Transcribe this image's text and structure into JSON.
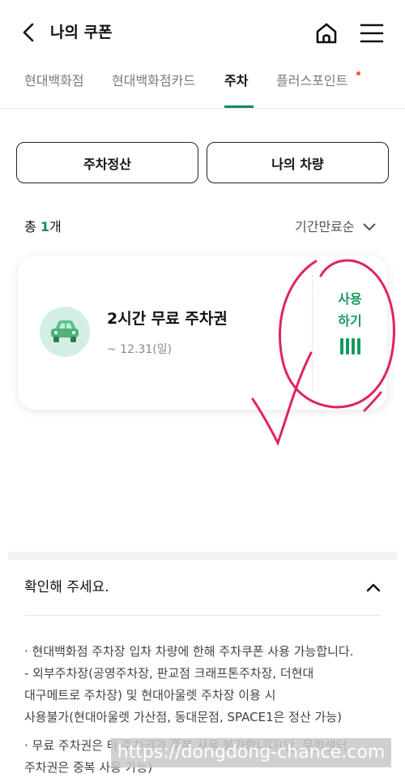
{
  "header": {
    "title": "나의 쿠폰"
  },
  "tabs": [
    {
      "label": "현대백화점"
    },
    {
      "label": "현대백화점카드"
    },
    {
      "label": "주차"
    },
    {
      "label": "플러스포인트"
    }
  ],
  "actions": {
    "parking_pay": "주차정산",
    "my_vehicle": "나의 차량"
  },
  "list": {
    "count_prefix": "총 ",
    "count": "1",
    "count_suffix": "개",
    "sort_label": "기간만료순"
  },
  "coupon": {
    "title": "2시간 무료 주차권",
    "expiry": "~ 12.31(일)",
    "use_label": "사용하기"
  },
  "notice": {
    "title": "확인해 주세요.",
    "lines": [
      "· 현대백화점 주차장 입차 차량에 한해 주차쿠폰 사용 가능합니다.",
      "  - 외부주차장(공영주차장, 판교점 크래프톤주차장, 더현대",
      "  대구메트로 주차장) 및 현대아울렛 주차장 이용 시",
      "  사용불가(현대아울렛 가산점, 동대문점, SPACE1은 정산 가능)",
      "· 무료 주차권은 타 주차권과 중복 사용 불가합니다(단, 문화센터",
      "  주차권은 중복 사용 가능)"
    ]
  },
  "watermark": "https://dongdong-chance.com",
  "colors": {
    "accent": "#0e8a6a",
    "use_green": "#17995d",
    "tab_dot": "#f05a28",
    "annotation": "#e0245e"
  }
}
